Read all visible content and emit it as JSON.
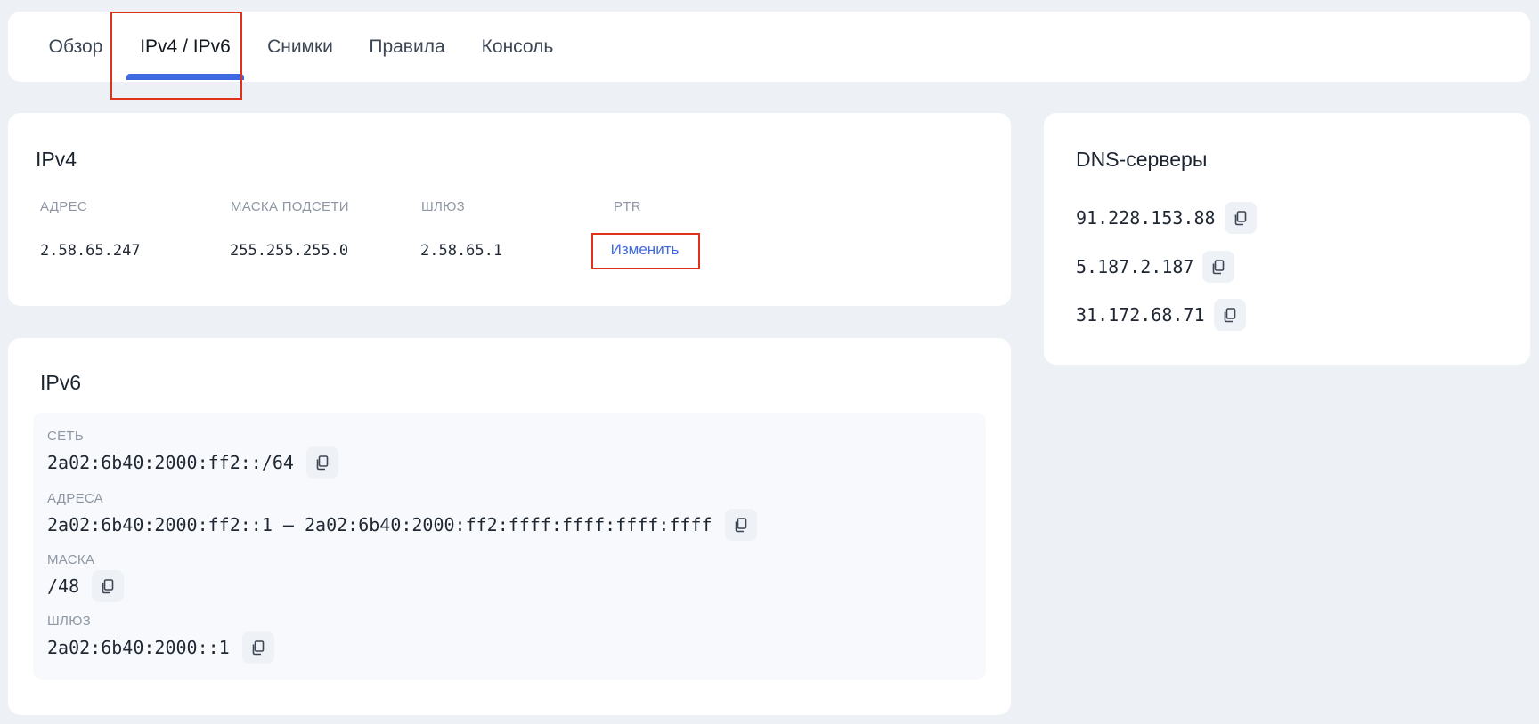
{
  "tabs": [
    {
      "label": "Обзор",
      "active": false
    },
    {
      "label": "IPv4 / IPv6",
      "active": true
    },
    {
      "label": "Снимки",
      "active": false
    },
    {
      "label": "Правила",
      "active": false
    },
    {
      "label": "Консоль",
      "active": false
    }
  ],
  "ipv4": {
    "title": "IPv4",
    "columns": [
      "АДРЕС",
      "МАСКА ПОДСЕТИ",
      "ШЛЮЗ",
      "PTR"
    ],
    "address": "2.58.65.247",
    "mask": "255.255.255.0",
    "gateway": "2.58.65.1",
    "ptr_action": "Изменить"
  },
  "dns": {
    "title": "DNS-серверы",
    "servers": [
      "91.228.153.88",
      "5.187.2.187",
      "31.172.68.71"
    ]
  },
  "ipv6": {
    "title": "IPv6",
    "network_label": "СЕТЬ",
    "network": "2a02:6b40:2000:ff2::/64",
    "addresses_label": "АДРЕСА",
    "addresses": "2a02:6b40:2000:ff2::1 — 2a02:6b40:2000:ff2:ffff:ffff:ffff:ffff",
    "mask_label": "МАСКА",
    "mask": "/48",
    "gateway_label": "ШЛЮЗ",
    "gateway": "2a02:6b40:2000::1"
  },
  "icons": {
    "copy": "copy-icon"
  },
  "colors": {
    "accent": "#3d6ae0",
    "highlight": "#e0321b"
  }
}
